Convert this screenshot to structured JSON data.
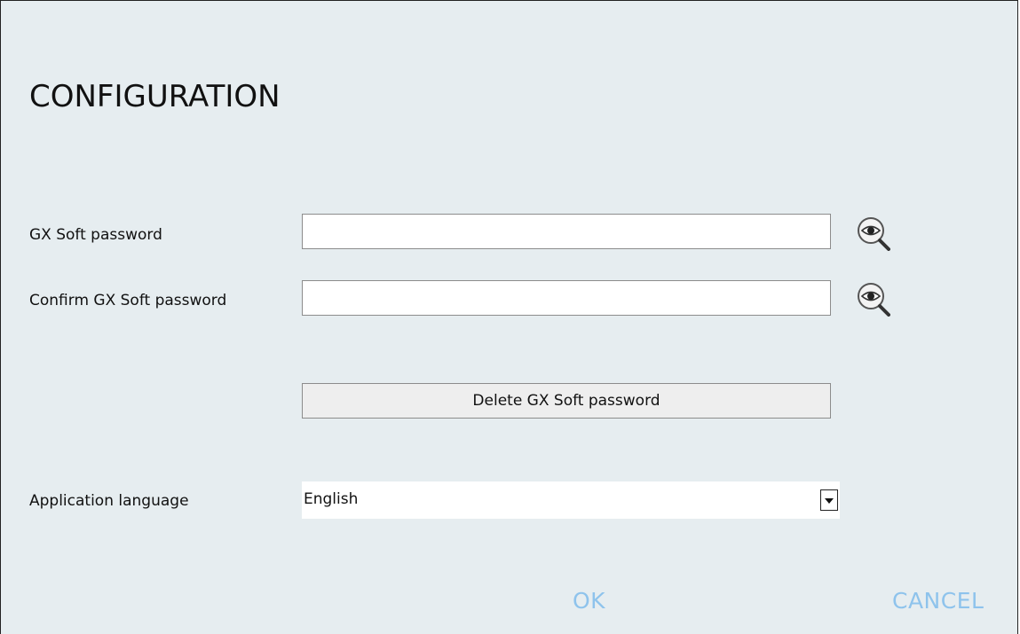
{
  "dialog": {
    "title": "CONFIGURATION"
  },
  "fields": {
    "password": {
      "label": "GX Soft password",
      "value": "",
      "placeholder": "",
      "reveal_icon": "eye-magnifier-icon"
    },
    "confirm_password": {
      "label": "Confirm GX Soft password",
      "value": "",
      "placeholder": "",
      "reveal_icon": "eye-magnifier-icon"
    }
  },
  "delete_button": {
    "label": "Delete GX Soft password"
  },
  "language": {
    "label": "Application language",
    "selected": "English"
  },
  "actions": {
    "ok_label": "OK",
    "cancel_label": "CANCEL"
  },
  "colors": {
    "background": "#e6edf0",
    "action_text": "#8ec3ec"
  }
}
